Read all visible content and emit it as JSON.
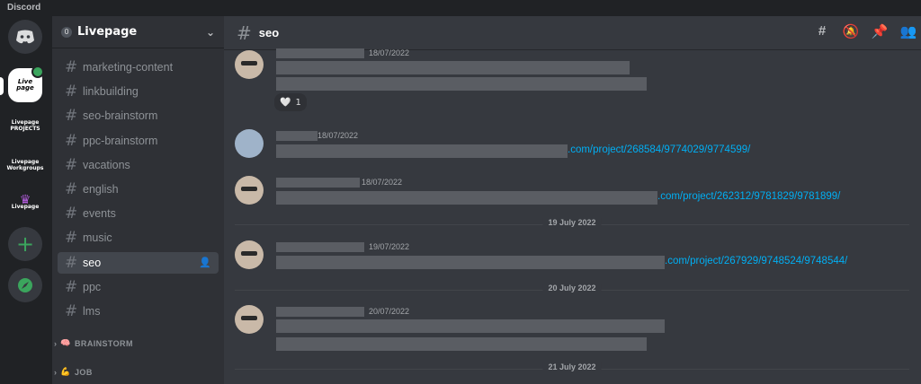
{
  "app": {
    "title": "Discord"
  },
  "servers": {
    "live_label": "Live page",
    "projects_label": "Livepage PROJECTS",
    "workgroups_label": "Livepage Workgroups",
    "king_label": "Livepage",
    "add_glyph": "+"
  },
  "guild": {
    "badge": "0",
    "name": "Livepage",
    "chevron": "⌄"
  },
  "channels": [
    {
      "name": "marketing-content"
    },
    {
      "name": "linkbuilding"
    },
    {
      "name": "seo-brainstorm"
    },
    {
      "name": "ppc-brainstorm"
    },
    {
      "name": "vacations"
    },
    {
      "name": "english"
    },
    {
      "name": "events"
    },
    {
      "name": "music"
    },
    {
      "name": "seo",
      "active": true
    },
    {
      "name": "ppc"
    },
    {
      "name": "lms"
    }
  ],
  "categories": [
    {
      "arrow": "›",
      "emoji": "🧠",
      "name": "BRAINSTORM"
    },
    {
      "arrow": "›",
      "emoji": "💪",
      "name": "JOB"
    }
  ],
  "channel_header": {
    "hash": "#",
    "name": "seo"
  },
  "messages": [
    {
      "timestamp": "18/07/2022",
      "reaction": {
        "emoji": "🤍",
        "count": "1"
      }
    },
    {
      "timestamp": "18/07/2022",
      "link": ".com/project/268584/9774029/9774599/"
    },
    {
      "timestamp": "18/07/2022",
      "link": ".com/project/262312/9781829/9781899/"
    },
    {
      "timestamp": "19/07/2022",
      "link": ".com/project/267929/9748524/9748544/"
    },
    {
      "timestamp": "20/07/2022"
    }
  ],
  "dividers": [
    "19 July 2022",
    "20 July 2022",
    "21 July 2022"
  ],
  "colors": {
    "accent": "#5865f2",
    "link": "#00aff4",
    "online": "#3ba55d"
  }
}
